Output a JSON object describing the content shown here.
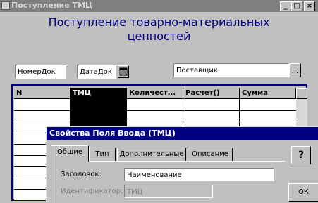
{
  "window": {
    "title": "Поступление ТМЦ",
    "heading_line1": "Поступление товарно-материальных",
    "heading_line2": "ценностей",
    "min_glyph": "_",
    "max_glyph": "□",
    "close_glyph": "×"
  },
  "form": {
    "doc_number": "НомерДок",
    "doc_date": "ДатаДок",
    "supplier": "Поставщик",
    "ellipsis": "..."
  },
  "grid": {
    "columns": [
      "N",
      "ТМЦ",
      "Количест...",
      "Расчет()",
      "Сумма"
    ],
    "selected_column": "ТМЦ"
  },
  "dialog": {
    "title": "Свойства  Поля Ввода (ТМЦ)",
    "tabs": [
      "Общие",
      "Тип",
      "Дополнительные",
      "Описание"
    ],
    "active_tab": "Общие",
    "caption_label": "Заголовок:",
    "caption_value": "Наименование",
    "id_label": "Идентификатор:",
    "id_value": "ТМЦ",
    "help_glyph": "?",
    "ok_label": "ОК"
  },
  "colors": {
    "title_inactive": "#7f7f7f",
    "title_active": "#000080",
    "heading": "#000080",
    "face": "#c0c0c0"
  },
  "icons": [
    "app-icon",
    "calendar-icon",
    "help-icon"
  ]
}
